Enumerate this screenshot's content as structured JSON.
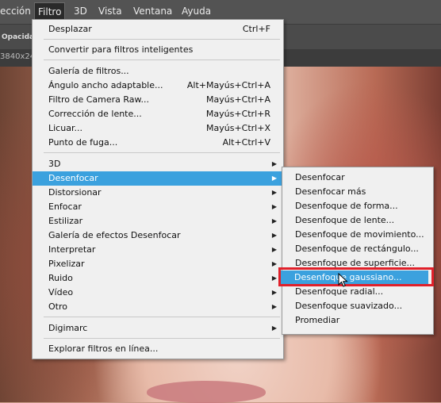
{
  "menubar": {
    "items": [
      "ección",
      "Filtro",
      "3D",
      "Vista",
      "Ventana",
      "Ayuda"
    ]
  },
  "options_bar": {
    "opacity_label": "Opacidad"
  },
  "document_tab": {
    "label": "3840x24"
  },
  "filter_menu": {
    "items": [
      {
        "label": "Desplazar",
        "shortcut": "Ctrl+F"
      },
      {
        "label": "Convertir para filtros inteligentes",
        "shortcut": ""
      },
      {
        "label": "Galería de filtros...",
        "shortcut": ""
      },
      {
        "label": "Ángulo ancho adaptable...",
        "shortcut": "Alt+Mayús+Ctrl+A"
      },
      {
        "label": "Filtro de Camera Raw...",
        "shortcut": "Mayús+Ctrl+A"
      },
      {
        "label": "Corrección de lente...",
        "shortcut": "Mayús+Ctrl+R"
      },
      {
        "label": "Licuar...",
        "shortcut": "Mayús+Ctrl+X"
      },
      {
        "label": "Punto de fuga...",
        "shortcut": "Alt+Ctrl+V"
      },
      {
        "label": "3D",
        "shortcut": ""
      },
      {
        "label": "Desenfocar",
        "shortcut": ""
      },
      {
        "label": "Distorsionar",
        "shortcut": ""
      },
      {
        "label": "Enfocar",
        "shortcut": ""
      },
      {
        "label": "Estilizar",
        "shortcut": ""
      },
      {
        "label": "Galería de efectos Desenfocar",
        "shortcut": ""
      },
      {
        "label": "Interpretar",
        "shortcut": ""
      },
      {
        "label": "Pixelizar",
        "shortcut": ""
      },
      {
        "label": "Ruido",
        "shortcut": ""
      },
      {
        "label": "Vídeo",
        "shortcut": ""
      },
      {
        "label": "Otro",
        "shortcut": ""
      },
      {
        "label": "Digimarc",
        "shortcut": ""
      },
      {
        "label": "Explorar filtros en línea...",
        "shortcut": ""
      }
    ]
  },
  "blur_submenu": {
    "items": [
      "Desenfocar",
      "Desenfocar más",
      "Desenfoque de forma...",
      "Desenfoque de lente...",
      "Desenfoque de movimiento...",
      "Desenfoque de rectángulo...",
      "Desenfoque de superficie...",
      "Desenfoque gaussiano...",
      "Desenfoque radial...",
      "Desenfoque suavizado...",
      "Promediar"
    ]
  },
  "colors": {
    "highlight": "#3ba1de",
    "callout_border": "#e0202a"
  }
}
